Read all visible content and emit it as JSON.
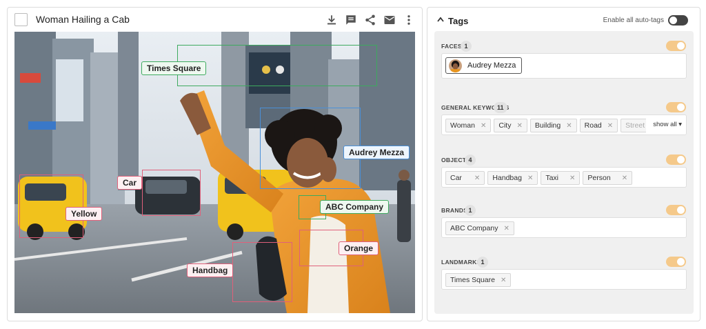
{
  "asset": {
    "title": "Woman Hailing a Cab"
  },
  "toolbar": {
    "icons": [
      "download-icon",
      "comment-icon",
      "share-icon",
      "mail-icon",
      "more-vertical-icon"
    ]
  },
  "annotations": [
    {
      "label": "Times Square",
      "color": "#3daa5e"
    },
    {
      "label": "Audrey Mezza",
      "color": "#4a90d9"
    },
    {
      "label": "Car",
      "color": "#e0607a"
    },
    {
      "label": "Yellow",
      "color": "#e0607a"
    },
    {
      "label": "ABC Company",
      "color": "#3daa5e"
    },
    {
      "label": "Orange",
      "color": "#e0607a"
    },
    {
      "label": "Handbag",
      "color": "#e0607a"
    }
  ],
  "tags_panel": {
    "title": "Tags",
    "auto_tags_label": "Enable all auto-tags",
    "auto_tags_enabled": false,
    "sections": [
      {
        "title": "FACES",
        "count": "1",
        "enabled": true,
        "items": [
          "Audrey Mezza"
        ]
      },
      {
        "title": "GENERAL KEYWORDS",
        "count": "11",
        "enabled": true,
        "items": [
          "Woman",
          "City",
          "Building",
          "Road",
          "Street Fashion"
        ],
        "show_all": "show all"
      },
      {
        "title": "OBJECT",
        "count": "4",
        "enabled": true,
        "items": [
          "Car",
          "Handbag",
          "Taxi",
          "Person"
        ]
      },
      {
        "title": "BRANDS",
        "count": "1",
        "enabled": true,
        "items": [
          "ABC Company"
        ]
      },
      {
        "title": "LANDMARKS",
        "count": "1",
        "enabled": true,
        "items": [
          "Times Square"
        ]
      }
    ]
  },
  "colors": {
    "accent_green": "#3daa5e",
    "accent_blue": "#4a90d9",
    "accent_pink": "#e0607a",
    "toggle_on": "#f5c98a"
  }
}
